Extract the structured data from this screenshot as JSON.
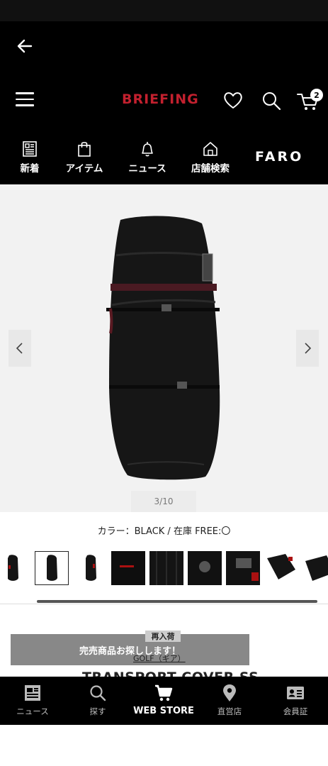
{
  "header": {
    "brand": "BRIEFING",
    "cart_count": "2",
    "nav": [
      {
        "label": "新着",
        "icon": "news-list-icon"
      },
      {
        "label": "アイテム",
        "icon": "bag-icon"
      },
      {
        "label": "ニュース",
        "icon": "bell-icon"
      },
      {
        "label": "店舗検索",
        "icon": "store-icon"
      }
    ],
    "faro": "FARO"
  },
  "gallery": {
    "counter": "3/10",
    "current_index": 3,
    "total": 10
  },
  "product": {
    "color_stock": "カラー：BLACK / 在庫 FREE:〇",
    "restock_badge": "再入荷",
    "soldout_button": "完売商品お探しします！",
    "category": "GOLF（ギア）",
    "title": "TRANSPORT COVER SS"
  },
  "bottom_nav": [
    {
      "label": "ニュース",
      "icon": "news-icon"
    },
    {
      "label": "探す",
      "icon": "search-icon"
    },
    {
      "label": "WEB STORE",
      "icon": "cart-icon",
      "active": true
    },
    {
      "label": "直営店",
      "icon": "location-pin-icon"
    },
    {
      "label": "会員証",
      "icon": "member-card-icon"
    }
  ],
  "colors": {
    "brand_red": "#c2202e",
    "header_bg": "#000000",
    "gallery_bg": "#f2f2f2"
  }
}
